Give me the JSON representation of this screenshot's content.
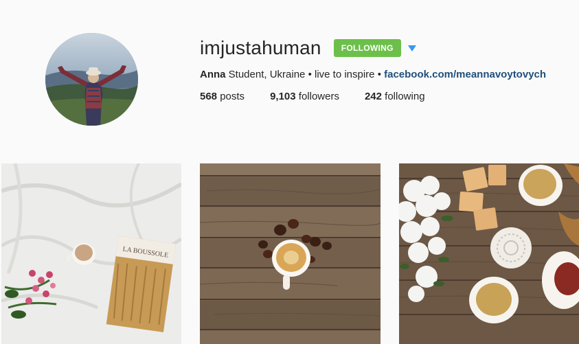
{
  "profile": {
    "username": "imjustahuman",
    "follow_button": "FOLLOWING",
    "bio": {
      "name": "Anna",
      "text": " Student, Ukraine • live to inspire • ",
      "link": "facebook.com/meannavoytovych"
    },
    "stats": {
      "posts_count": "568",
      "posts_label": " posts",
      "followers_count": "9,103",
      "followers_label": " followers",
      "following_count": "242",
      "following_label": " following"
    }
  },
  "posts": [
    {
      "book_title": "LA BOUSSOLE"
    },
    {},
    {}
  ],
  "colors": {
    "follow_green": "#6cc04a",
    "link_blue": "#1f4f7b",
    "dropdown_blue": "#3897f0"
  }
}
